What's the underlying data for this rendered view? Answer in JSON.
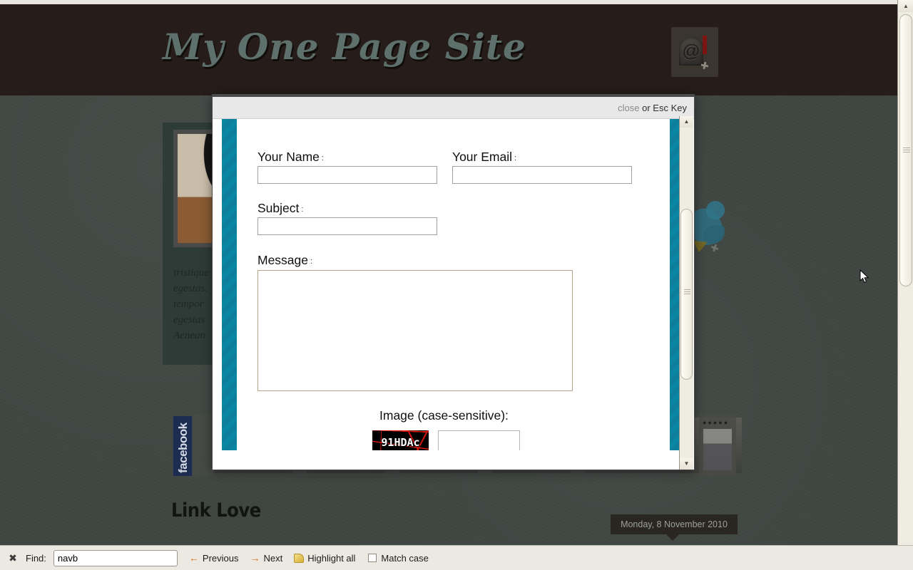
{
  "site": {
    "title": "My One Page Site",
    "mail_icon": "mailbox-at-icon"
  },
  "feature_card": {
    "excerpt": "tristique\negestas.\ntempor\negestas\nAenean"
  },
  "social": {
    "facebook_label": "facebook",
    "twitter_icon": "twitter-bird-icon"
  },
  "section": {
    "link_love_title": "Link Love",
    "date_tooltip": "Monday, 8 November 2010"
  },
  "modal": {
    "close_label": "close",
    "esc_hint": "or Esc Key",
    "fields": {
      "name_label": "Your Name",
      "name_value": "",
      "email_label": "Your Email",
      "email_value": "",
      "subject_label": "Subject",
      "subject_value": "",
      "message_label": "Message",
      "message_value": "",
      "captcha_label": "Image (case-sensitive)",
      "captcha_text": "91HDAc",
      "captcha_value": "",
      "colon": ":"
    },
    "submit_label": "",
    "accent_color": "#0b85a4",
    "submit_color": "#1b9ec0"
  },
  "find_bar": {
    "close_icon": "close-icon",
    "label": "Find:",
    "query": "navb",
    "placeholder": "",
    "previous_label": "Previous",
    "next_label": "Next",
    "highlight_label": "Highlight all",
    "match_case_label": "Match case",
    "match_case_checked": false,
    "prev_arrow": "←",
    "next_arrow": "→"
  },
  "scrollbars": {
    "up_arrow": "▲",
    "down_arrow": "▼"
  }
}
